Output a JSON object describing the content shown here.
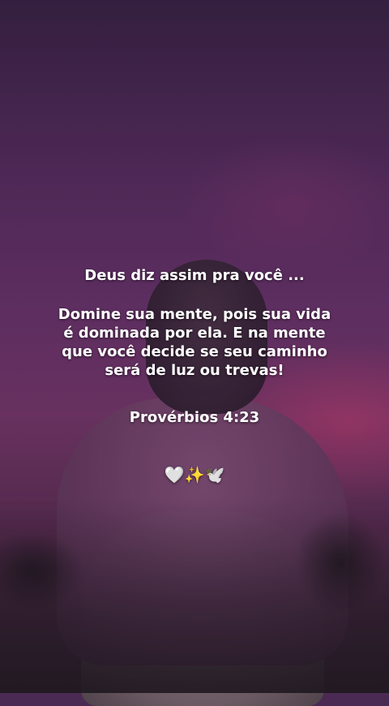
{
  "heading": "Deus diz assim pra você ...",
  "message_lines": [
    "Domine sua mente, pois sua vida",
    "é dominada por ela. E na mente",
    "que você decide se seu caminho",
    "será de luz ou trevas!"
  ],
  "reference": "Provérbios 4:23",
  "emojis": "🤍✨🕊️"
}
